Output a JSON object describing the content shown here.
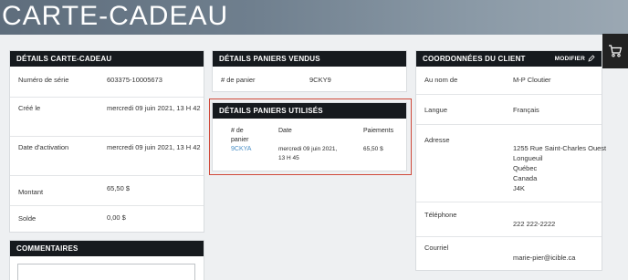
{
  "page": {
    "title": "CARTE-CADEAU"
  },
  "card_details": {
    "heading": "DÉTAILS CARTE-CADEAU",
    "rows": [
      {
        "label": "Numéro de série",
        "value": "603375-10005673"
      },
      {
        "label": "Créé le",
        "value": "mercredi 09 juin 2021, 13 H 42"
      },
      {
        "label": "Date d'activation",
        "value": "mercredi 09 juin 2021, 13 H 42"
      },
      {
        "label": "Montant",
        "value": "65,50 $"
      },
      {
        "label": "Solde",
        "value": "0,00 $"
      }
    ]
  },
  "comments": {
    "heading": "COMMENTAIRES"
  },
  "sold_carts": {
    "heading": "DÉTAILS PANIERS VENDUS",
    "label": "# de panier",
    "value": "9CKY9"
  },
  "used_carts": {
    "heading": "DÉTAILS PANIERS UTILISÉS",
    "col_cart": "# de panier",
    "col_date": "Date",
    "col_payment": "Paiements",
    "row": {
      "cart": "9CKYA",
      "date": "mercredi 09 juin 2021, 13 H 45",
      "payment": "65,50 $"
    }
  },
  "client": {
    "heading": "COORDONNÉES DU CLIENT",
    "edit_label": "MODIFIER",
    "name_label": "Au nom de",
    "name": "M-P Cloutier",
    "lang_label": "Langue",
    "lang": "Français",
    "address_label": "Adresse",
    "address_lines": [
      "1255 Rue Saint-Charles Ouest",
      "Longueuil",
      "Québec",
      "Canada",
      "J4K"
    ],
    "phone_label": "Téléphone",
    "phone": "222 222-2222",
    "email_label": "Courriel",
    "email": "marie-pier@icible.ca"
  },
  "icons": {
    "cart": "cart-icon",
    "edit": "pencil-icon"
  },
  "colors": {
    "header_bg": "#161a1e",
    "link": "#4a8fc6",
    "highlight": "#d0493a"
  }
}
